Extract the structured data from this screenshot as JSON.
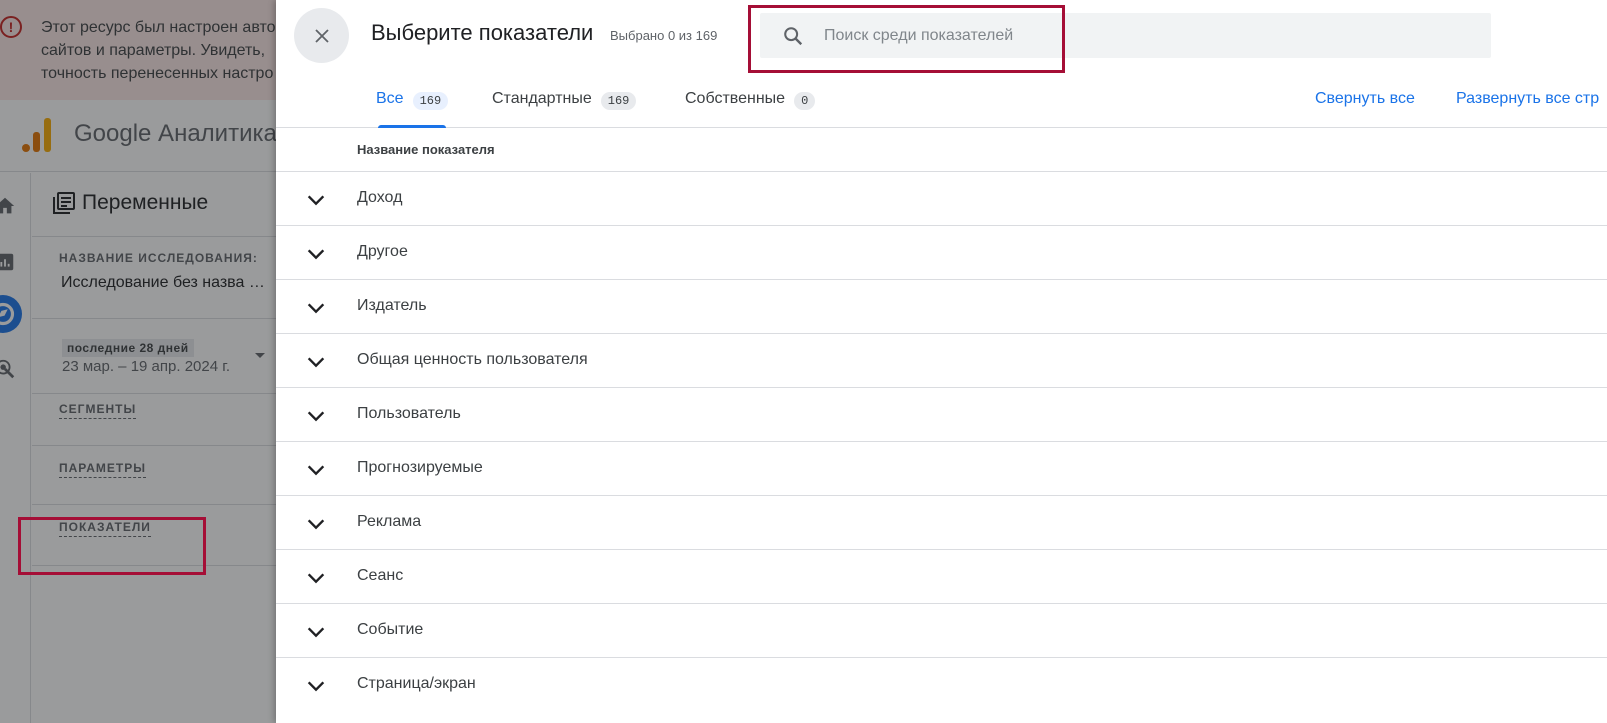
{
  "background": {
    "banner": {
      "lines": [
        "Этот ресурс был настроен авто",
        "сайтов и параметры. Увидеть,",
        "точность перенесенных настро"
      ]
    },
    "app_title": "Google Аналитика",
    "variables_panel": {
      "title": "Переменные",
      "exploration_name_caption": "НАЗВАНИЕ ИССЛЕДОВАНИЯ:",
      "exploration_name": "Исследование без назва  …",
      "date_chip": "последние 28 дней",
      "date_range": "23 мар. – 19 апр. 2024 г.",
      "segments_label": "СЕГМЕНТЫ",
      "dimensions_label": "ПАРАМЕТРЫ",
      "metrics_label": "ПОКАЗАТЕЛИ"
    }
  },
  "dialog": {
    "title": "Выберите показатели",
    "selected_text": "Выбрано 0 из 169",
    "search": {
      "placeholder": "Поиск среди показателей",
      "value": ""
    },
    "tabs": [
      {
        "label": "Все",
        "count": "169",
        "active": true
      },
      {
        "label": "Стандартные",
        "count": "169",
        "active": false
      },
      {
        "label": "Собственные",
        "count": "0",
        "active": false
      }
    ],
    "collapse_all": "Свернуть все",
    "expand_all": "Развернуть все стр",
    "column_header": "Название показателя",
    "categories": [
      "Доход",
      "Другое",
      "Издатель",
      "Общая ценность пользователя",
      "Пользователь",
      "Прогнозируемые",
      "Реклама",
      "Сеанс",
      "Событие",
      "Страница/экран"
    ]
  },
  "colors": {
    "accent": "#1a73e8",
    "highlight": "#a50e36",
    "banner_bg": "#fce8e6",
    "overlay": "rgba(32,33,36,0.45)"
  }
}
